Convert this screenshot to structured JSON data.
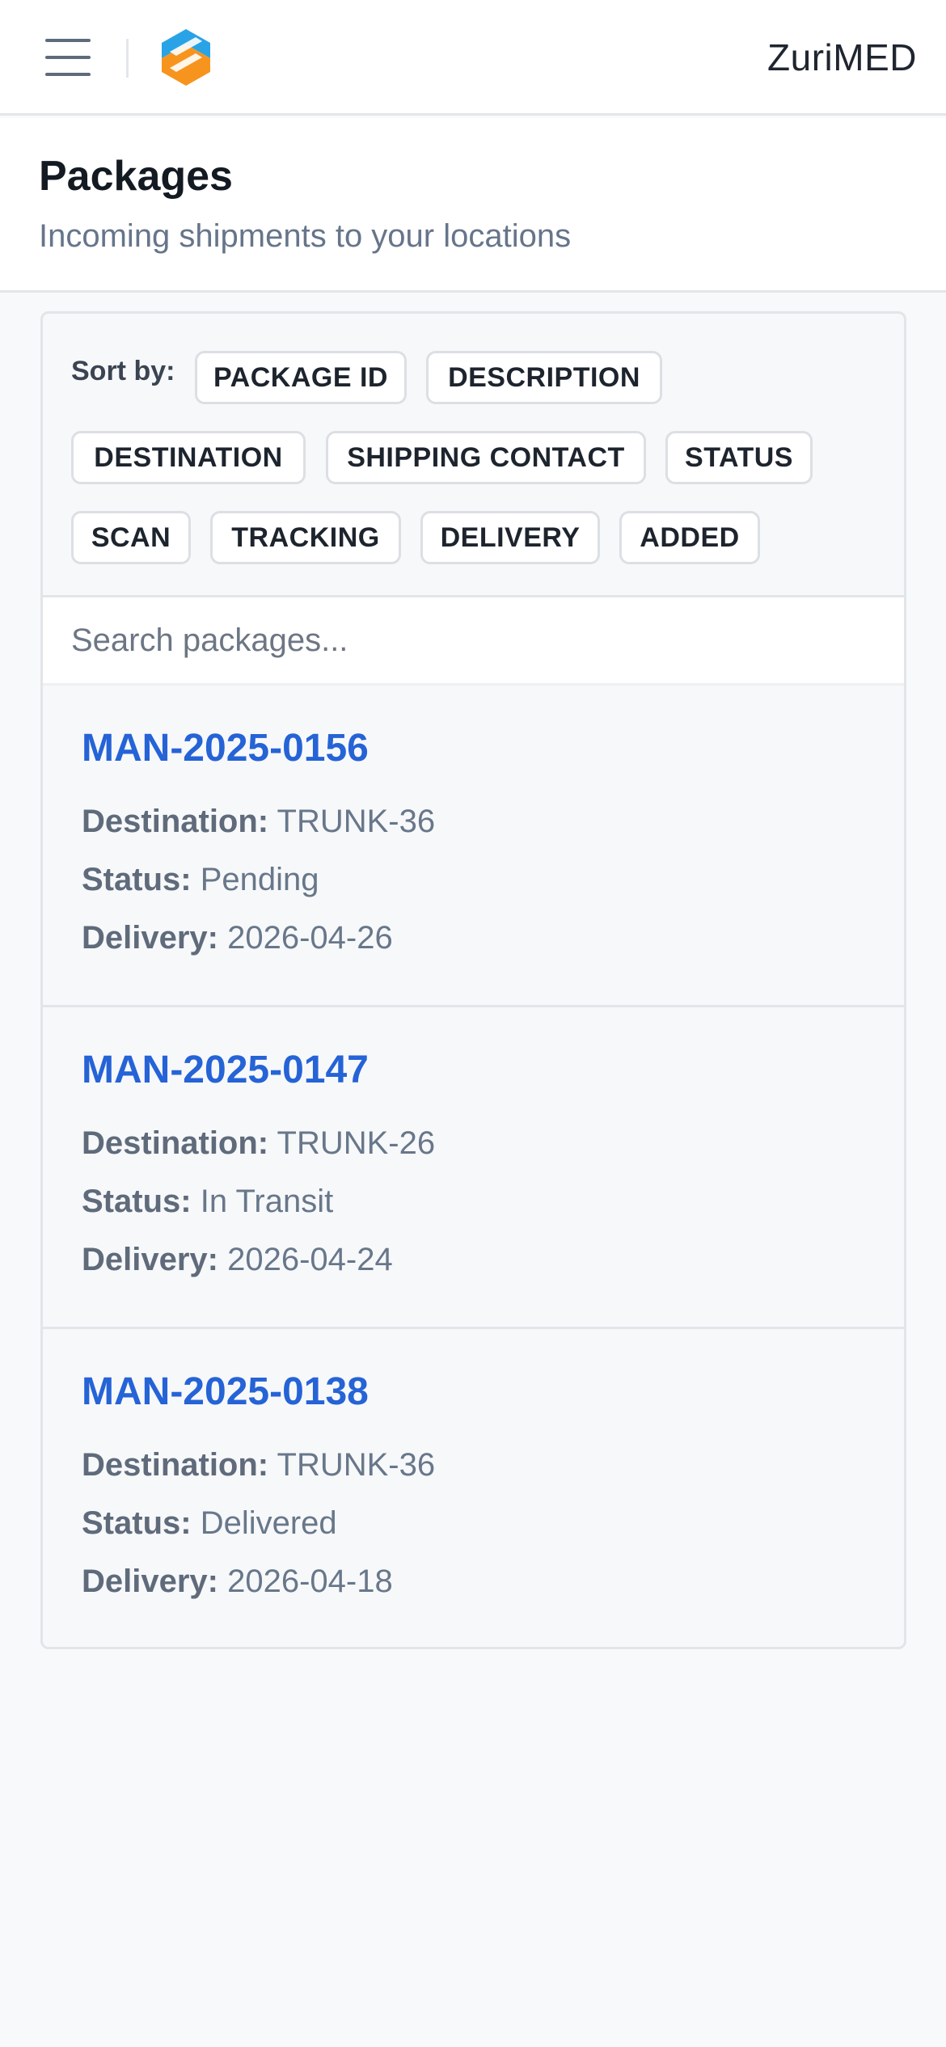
{
  "app": {
    "brand": "ZuriMED"
  },
  "header": {
    "title": "Packages",
    "subtitle": "Incoming shipments to your locations"
  },
  "sort": {
    "label": "Sort by:",
    "options": [
      "PACKAGE ID",
      "DESCRIPTION",
      "DESTINATION",
      "SHIPPING CONTACT",
      "STATUS",
      "SCAN",
      "TRACKING",
      "DELIVERY",
      "ADDED"
    ]
  },
  "search": {
    "placeholder": "Search packages..."
  },
  "fields": {
    "destination": "Destination:",
    "status": "Status:",
    "delivery": "Delivery:"
  },
  "packages": [
    {
      "id": "MAN-2025-0156",
      "destination": "TRUNK-36",
      "status": "Pending",
      "delivery": "2026-04-26"
    },
    {
      "id": "MAN-2025-0147",
      "destination": "TRUNK-26",
      "status": "In Transit",
      "delivery": "2026-04-24"
    },
    {
      "id": "MAN-2025-0138",
      "destination": "TRUNK-36",
      "status": "Delivered",
      "delivery": "2026-04-18"
    }
  ],
  "colors": {
    "link": "#2563d6",
    "logo_blue": "#2aa3e6",
    "logo_orange": "#f7941d"
  },
  "icons": {
    "menu": "hamburger-menu-icon",
    "logo": "zurimed-logo-icon"
  }
}
